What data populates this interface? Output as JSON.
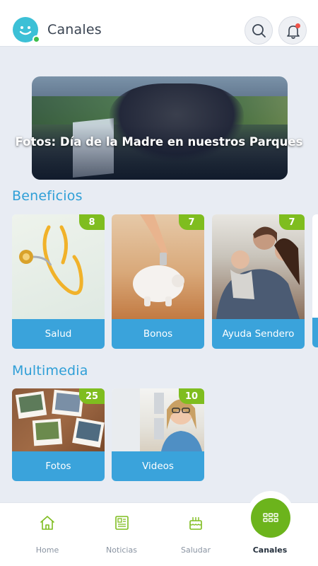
{
  "header": {
    "title": "Canales",
    "logo_icon": "smiley-logo-icon",
    "search_icon": "search-icon",
    "notifications_icon": "bell-icon",
    "has_unread_notifications": true
  },
  "hero": {
    "title": "Fotos: Día de la Madre en nuestros Parques"
  },
  "beneficios": {
    "title": "Beneficios",
    "cards": [
      {
        "label": "Salud",
        "badge": "8",
        "image": "stethoscope"
      },
      {
        "label": "Bonos",
        "badge": "7",
        "image": "piggy-bank"
      },
      {
        "label": "Ayuda Sendero",
        "badge": "7",
        "image": "family"
      }
    ]
  },
  "multimedia": {
    "title": "Multimedia",
    "cards": [
      {
        "label": "Fotos",
        "badge": "25",
        "image": "photos"
      },
      {
        "label": "Videos",
        "badge": "10",
        "image": "woman-smiling"
      }
    ]
  },
  "bottom_nav": {
    "items": [
      {
        "label": "Home",
        "icon": "home-icon",
        "active": false
      },
      {
        "label": "Noticias",
        "icon": "newspaper-icon",
        "active": false
      },
      {
        "label": "Saludar",
        "icon": "cake-icon",
        "active": false
      },
      {
        "label": "Canales",
        "icon": "grid-icon",
        "active": true
      }
    ]
  },
  "colors": {
    "accent_blue": "#3aa3db",
    "badge_green": "#7fbd1f",
    "fab_green": "#6cb41c",
    "section_title": "#2f9fd7",
    "background": "#e8ecf3"
  }
}
